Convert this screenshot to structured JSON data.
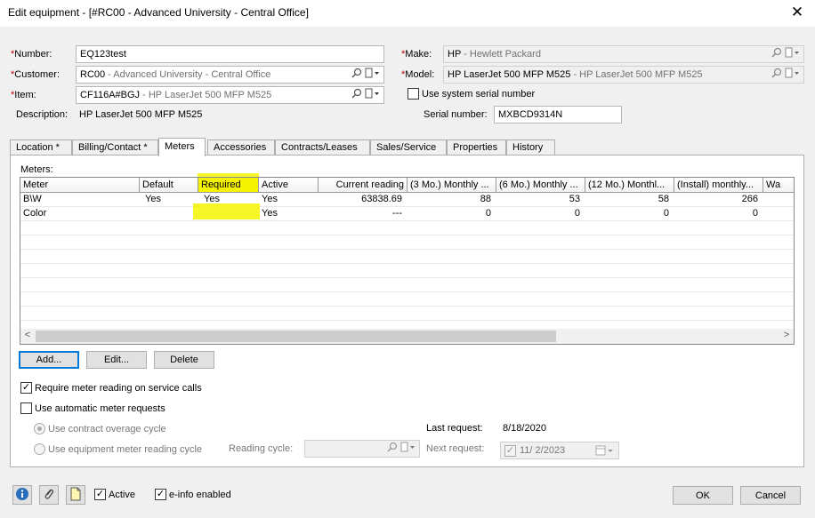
{
  "window": {
    "title": "Edit equipment - [#RC00 - Advanced University - Central Office]",
    "close": "✕"
  },
  "fields": {
    "number": {
      "label": "Number:",
      "value": "EQ123test"
    },
    "customer": {
      "label": "Customer:",
      "code": "RC00",
      "desc": " - Advanced University - Central Office"
    },
    "item": {
      "label": "Item:",
      "code": "CF116A#BGJ",
      "desc": " - HP LaserJet 500 MFP M525"
    },
    "description": {
      "label": "Description:",
      "value": "HP LaserJet 500 MFP M525"
    },
    "make": {
      "label": "Make:",
      "code": "HP",
      "desc": " - Hewlett Packard"
    },
    "model": {
      "label": "Model:",
      "code": "HP LaserJet 500 MFP M525",
      "desc": " - HP LaserJet 500 MFP M525"
    },
    "use_system_serial": {
      "label": "Use system serial number",
      "checked": false
    },
    "serial": {
      "label": "Serial number:",
      "value": "MXBCD9314N"
    },
    "required_mark": "*"
  },
  "tabs": [
    {
      "label": "Location *",
      "active": false
    },
    {
      "label": "Billing/Contact *",
      "active": false
    },
    {
      "label": "Meters",
      "active": true
    },
    {
      "label": "Accessories",
      "active": false
    },
    {
      "label": "Contracts/Leases",
      "active": false
    },
    {
      "label": "Sales/Service",
      "active": false
    },
    {
      "label": "Properties",
      "active": false
    },
    {
      "label": "History",
      "active": false
    }
  ],
  "meters": {
    "label": "Meters:",
    "columns": [
      "Meter",
      "Default",
      "Required",
      "Active",
      "Current reading",
      "(3 Mo.) Monthly ...",
      "(6 Mo.) Monthly ...",
      "(12 Mo.) Monthl...",
      "(Install) monthly...",
      "Wa"
    ],
    "rows": [
      [
        "B\\W",
        "Yes",
        "Yes",
        "Yes",
        "63838.69",
        "88",
        "53",
        "58",
        "266",
        ""
      ],
      [
        "Color",
        "",
        "",
        "Yes",
        "---",
        "0",
        "0",
        "0",
        "0",
        ""
      ]
    ],
    "scroll_left": "<",
    "scroll_right": ">"
  },
  "buttons": {
    "add": "Add...",
    "edit": "Edit...",
    "delete": "Delete",
    "ok": "OK",
    "cancel": "Cancel"
  },
  "options": {
    "require_reading": {
      "label": "Require meter reading on service calls",
      "checked": true
    },
    "auto_requests": {
      "label": "Use automatic meter requests",
      "checked": false
    },
    "contract_cycle": {
      "label": "Use contract overage cycle",
      "selected": true
    },
    "equipment_cycle": {
      "label": "Use equipment meter reading cycle",
      "selected": false
    },
    "reading_cycle": {
      "label": "Reading cycle:",
      "value": ""
    },
    "last_request": {
      "label": "Last request:",
      "value": "8/18/2020"
    },
    "next_request": {
      "label": "Next request:",
      "value": "11/  2/2023",
      "checked": true
    }
  },
  "footer": {
    "active": {
      "label": "Active",
      "checked": true
    },
    "einfo": {
      "label": "e-info enabled",
      "checked": true
    }
  },
  "colors": {
    "highlight": "#f5f300",
    "focus": "#0078d7",
    "required": "#c00000"
  }
}
